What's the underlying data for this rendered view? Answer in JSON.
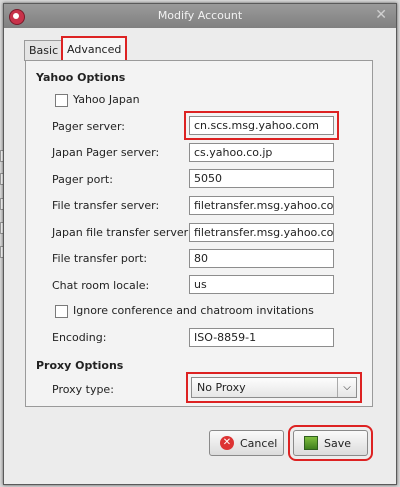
{
  "window": {
    "title": "Modify Account"
  },
  "tabs": {
    "basic": "Basic",
    "advanced": "Advanced"
  },
  "yahoo": {
    "section": "Yahoo Options",
    "yahoo_japan": "Yahoo Japan",
    "pager_server": {
      "label": "Pager server:",
      "value": "cn.scs.msg.yahoo.com"
    },
    "japan_pager_server": {
      "label": "Japan Pager server:",
      "value": "cs.yahoo.co.jp"
    },
    "pager_port": {
      "label": "Pager port:",
      "value": "5050"
    },
    "file_transfer_server": {
      "label": "File transfer server:",
      "value": "filetransfer.msg.yahoo.com"
    },
    "japan_file_transfer_server": {
      "label": "Japan file transfer server:",
      "value": "filetransfer.msg.yahoo.co.jp"
    },
    "file_transfer_port": {
      "label": "File transfer port:",
      "value": "80"
    },
    "chat_room_locale": {
      "label": "Chat room locale:",
      "value": "us"
    },
    "ignore_invites": "Ignore conference and chatroom invitations",
    "encoding": {
      "label": "Encoding:",
      "value": "ISO-8859-1"
    }
  },
  "proxy": {
    "section": "Proxy Options",
    "type_label": "Proxy type:",
    "type_value": "No Proxy"
  },
  "buttons": {
    "cancel": "Cancel",
    "save": "Save"
  }
}
